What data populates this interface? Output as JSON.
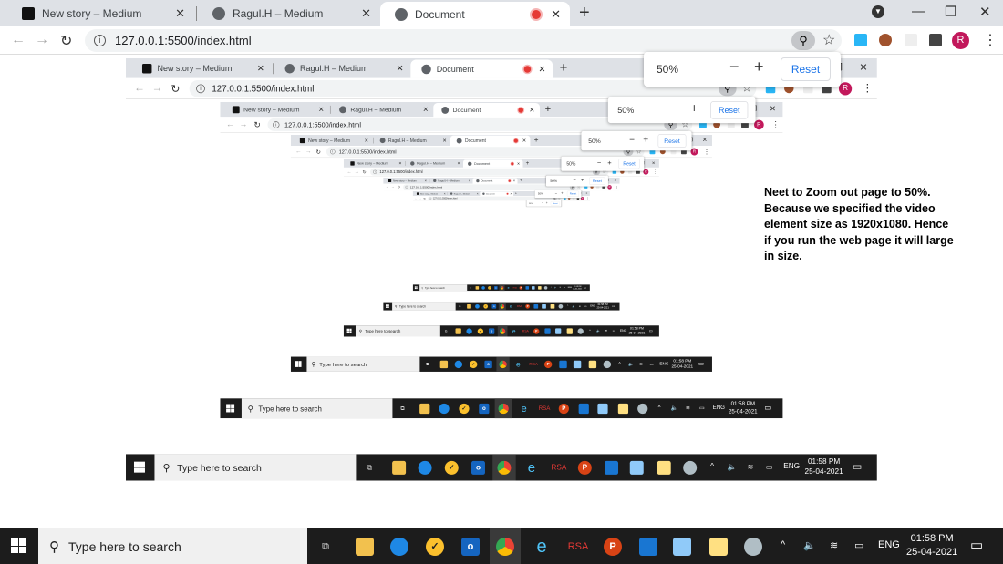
{
  "browser": {
    "tabs": [
      {
        "label": "New story – Medium",
        "icon": "medium-icon"
      },
      {
        "label": "Ragul.H – Medium",
        "icon": "globe-icon"
      },
      {
        "label": "Document",
        "icon": "globe-icon",
        "active": true,
        "recording": true
      }
    ],
    "url": "127.0.0.1:5500/index.html",
    "profile_initial": "R",
    "profile_color": "#c2185b"
  },
  "zoom_popup": {
    "level": "50%",
    "minus": "−",
    "plus": "+",
    "reset": "Reset"
  },
  "page": {
    "note": "Neet to Zoom out page to 50%. Because we specified the video element size as 1920x1080. Hence if you run the web page it will large in size."
  },
  "taskbar": {
    "search_placeholder": "Type here to search",
    "apps": [
      "task-view",
      "file-explorer",
      "edge",
      "norton",
      "outlook",
      "chrome",
      "internet-explorer",
      "rsa",
      "powerpoint",
      "vscode",
      "notepad",
      "python-idle",
      "paint"
    ],
    "rsa_label": "RSA",
    "language": "ENG",
    "time": "01:58 PM",
    "date": "25-04-2021"
  }
}
